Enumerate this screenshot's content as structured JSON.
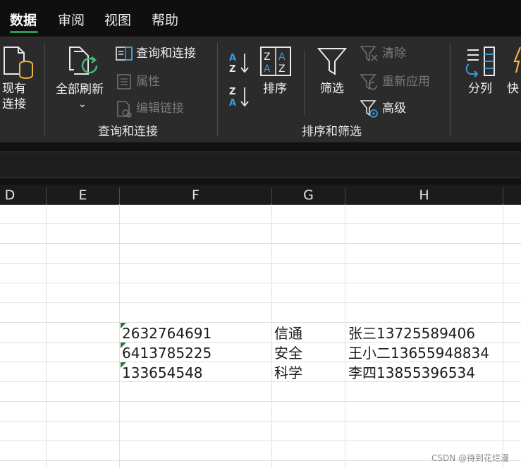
{
  "tabs": [
    "数据",
    "审阅",
    "视图",
    "帮助"
  ],
  "active_tab": "数据",
  "ribbon": {
    "existing_connection": [
      "现有",
      "连接"
    ],
    "refresh_all": "全部刷新",
    "refresh_caret": "⌄",
    "query_connection": "查询和连接",
    "properties": "属性",
    "edit_links": "编辑链接",
    "group_query": "查询和连接",
    "sort": "排序",
    "filter": "筛选",
    "clear": "清除",
    "reapply": "重新应用",
    "advanced": "高级",
    "group_sort_filter": "排序和筛选",
    "text_to_columns": "分列",
    "flash_fill_partial": "快"
  },
  "columns": [
    "D",
    "E",
    "F",
    "G",
    "H"
  ],
  "rows": [
    {
      "F": "2632764691",
      "G": "信通",
      "H": "张三13725589406"
    },
    {
      "F": "6413785225",
      "G": "安全",
      "H": "王小二13655948834"
    },
    {
      "F": "133654548",
      "G": "科学",
      "H": "李四13855396534"
    }
  ],
  "watermark": "CSDN @待到花烂漫",
  "colors": {
    "accent": "#2a9d55",
    "icon_green": "#3fbf6f",
    "icon_blue": "#3a9ad9",
    "icon_orange": "#f0b340",
    "error_triangle": "#1e7b34"
  }
}
